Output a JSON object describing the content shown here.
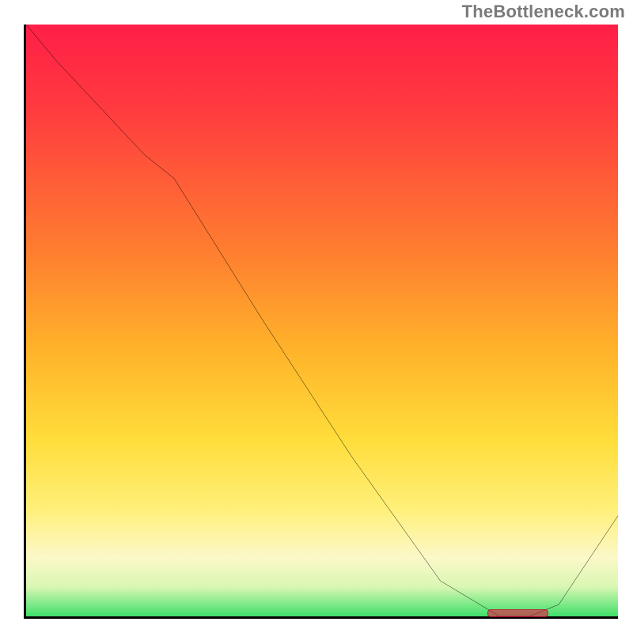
{
  "watermark": "TheBottleneck.com",
  "colors": {
    "axis": "#000000",
    "curve": "#000000",
    "watermark": "#7a7a7a",
    "marker": "rgba(255,0,64,0.55)",
    "gradient_stops": [
      "#ff1f47",
      "#ff3a3f",
      "#ff7d30",
      "#ffb32a",
      "#ffdd3a",
      "#fff07a",
      "#fcf8c8",
      "#d9f7b3",
      "#3fe06a"
    ]
  },
  "chart_data": {
    "type": "line",
    "title": "",
    "xlabel": "",
    "ylabel": "",
    "xlim": [
      0,
      100
    ],
    "ylim": [
      0,
      100
    ],
    "grid": false,
    "series": [
      {
        "name": "bottleneck-curve",
        "x": [
          0,
          5,
          20,
          25,
          40,
          55,
          70,
          80,
          85,
          90,
          100
        ],
        "y": [
          100,
          94,
          78,
          74,
          50,
          27,
          6,
          0,
          0,
          2,
          17
        ]
      }
    ],
    "annotations": [
      {
        "name": "optimal-range-marker",
        "x_start": 78,
        "x_end": 88,
        "y": 0
      }
    ]
  }
}
